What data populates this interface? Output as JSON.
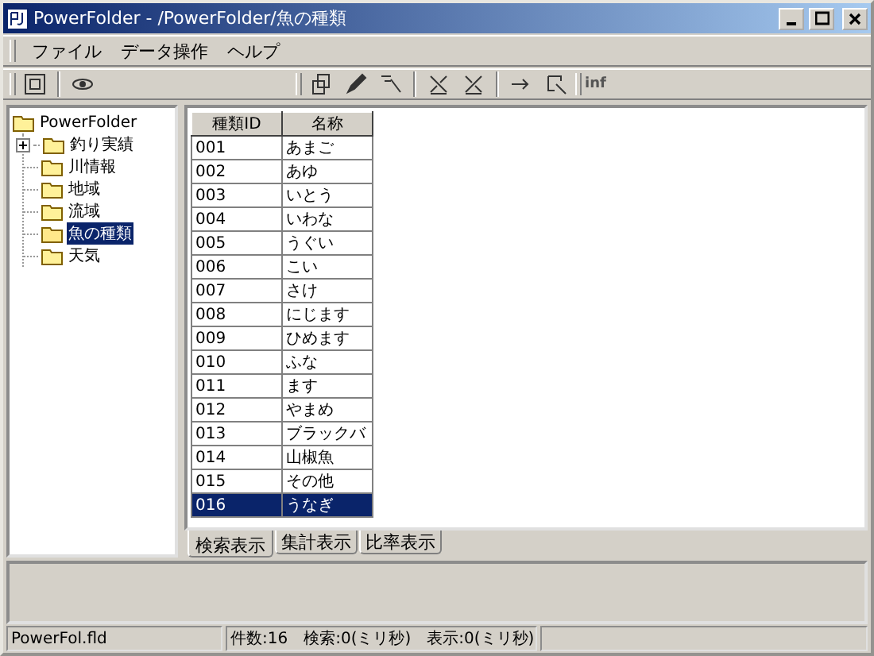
{
  "window": {
    "title": "PowerFolder - /PowerFolder/魚の種類"
  },
  "menu": [
    "ファイル",
    "データ操作",
    "ヘルプ"
  ],
  "toolbar": {
    "info_label": "inf"
  },
  "tree": {
    "label": "PowerFolder",
    "children": [
      {
        "label": "釣り実績",
        "expandable": true,
        "selected": false
      },
      {
        "label": "川情報",
        "expandable": false,
        "selected": false
      },
      {
        "label": "地域",
        "expandable": false,
        "selected": false
      },
      {
        "label": "流域",
        "expandable": false,
        "selected": false
      },
      {
        "label": "魚の種類",
        "expandable": false,
        "selected": true
      },
      {
        "label": "天気",
        "expandable": false,
        "selected": false
      }
    ]
  },
  "table": {
    "columns": [
      "種類ID",
      "名称"
    ],
    "rows": [
      {
        "cells": [
          "001",
          "あまご"
        ],
        "selected": false
      },
      {
        "cells": [
          "002",
          "あゆ"
        ],
        "selected": false
      },
      {
        "cells": [
          "003",
          "いとう"
        ],
        "selected": false
      },
      {
        "cells": [
          "004",
          "いわな"
        ],
        "selected": false
      },
      {
        "cells": [
          "005",
          "うぐい"
        ],
        "selected": false
      },
      {
        "cells": [
          "006",
          "こい"
        ],
        "selected": false
      },
      {
        "cells": [
          "007",
          "さけ"
        ],
        "selected": false
      },
      {
        "cells": [
          "008",
          "にじます"
        ],
        "selected": false
      },
      {
        "cells": [
          "009",
          "ひめます"
        ],
        "selected": false
      },
      {
        "cells": [
          "010",
          "ふな"
        ],
        "selected": false
      },
      {
        "cells": [
          "011",
          "ます"
        ],
        "selected": false
      },
      {
        "cells": [
          "012",
          "やまめ"
        ],
        "selected": false
      },
      {
        "cells": [
          "013",
          "ブラックバ"
        ],
        "selected": false
      },
      {
        "cells": [
          "014",
          "山椒魚"
        ],
        "selected": false
      },
      {
        "cells": [
          "015",
          "その他"
        ],
        "selected": false
      },
      {
        "cells": [
          "016",
          "うなぎ"
        ],
        "selected": true
      }
    ]
  },
  "tabs": [
    {
      "label": "検索表示",
      "selected": true
    },
    {
      "label": "集計表示",
      "selected": false
    },
    {
      "label": "比率表示",
      "selected": false
    }
  ],
  "status_bar": [
    "PowerFol.fld",
    "件数:16　検索:0(ミリ秒)　表示:0(ミリ秒)"
  ]
}
